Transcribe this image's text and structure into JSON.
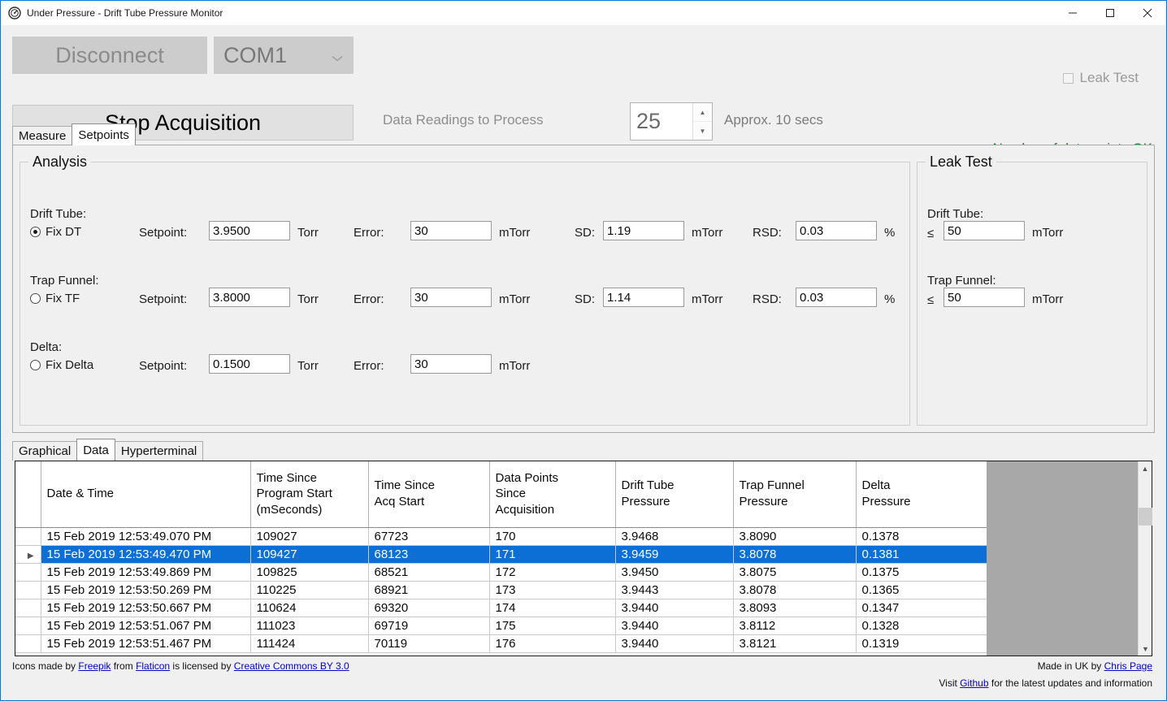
{
  "window": {
    "title": "Under Pressure - Drift Tube Pressure Monitor",
    "app_icon": "gauge-icon",
    "minimize": "minimize-icon",
    "maximize": "maximize-icon",
    "close": "close-icon"
  },
  "toolbar": {
    "disconnect_label": "Disconnect",
    "port_value": "COM1",
    "stop_label": "Stop Acquisition",
    "readings_label": "Data Readings to Process",
    "readings_value": "25",
    "approx_label": "Approx. 10 secs",
    "leak_test_label": "Leak Test",
    "status_label": "Number of data points OK",
    "status_color": "#0b8a1e"
  },
  "main_tabs": [
    {
      "label": "Measure",
      "active": false
    },
    {
      "label": "Setpoints",
      "active": true
    }
  ],
  "analysis": {
    "title": "Analysis",
    "drift_tube": {
      "group_label": "Drift Tube:",
      "radio_label": "Fix DT",
      "radio_checked": true,
      "setpoint_label": "Setpoint:",
      "setpoint_value": "3.9500",
      "setpoint_unit": "Torr",
      "error_label": "Error:",
      "error_value": "30",
      "error_unit": "mTorr",
      "sd_label": "SD:",
      "sd_value": "1.19",
      "sd_unit": "mTorr",
      "rsd_label": "RSD:",
      "rsd_value": "0.03",
      "rsd_unit": "%"
    },
    "trap_funnel": {
      "group_label": "Trap Funnel:",
      "radio_label": "Fix TF",
      "radio_checked": false,
      "setpoint_label": "Setpoint:",
      "setpoint_value": "3.8000",
      "setpoint_unit": "Torr",
      "error_label": "Error:",
      "error_value": "30",
      "error_unit": "mTorr",
      "sd_label": "SD:",
      "sd_value": "1.14",
      "sd_unit": "mTorr",
      "rsd_label": "RSD:",
      "rsd_value": "0.03",
      "rsd_unit": "%"
    },
    "delta": {
      "group_label": "Delta:",
      "radio_label": "Fix Delta",
      "radio_checked": false,
      "setpoint_label": "Setpoint:",
      "setpoint_value": "0.1500",
      "setpoint_unit": "Torr",
      "error_label": "Error:",
      "error_value": "30",
      "error_unit": "mTorr"
    }
  },
  "leak_test": {
    "title": "Leak Test",
    "drift_tube_label": "Drift Tube:",
    "drift_tube_op": "≤",
    "drift_tube_value": "50",
    "drift_tube_unit": "mTorr",
    "trap_funnel_label": "Trap Funnel:",
    "trap_funnel_op": "≤",
    "trap_funnel_value": "50",
    "trap_funnel_unit": "mTorr"
  },
  "bottom_tabs": [
    {
      "label": "Graphical",
      "active": false
    },
    {
      "label": "Data",
      "active": true
    },
    {
      "label": "Hyperterminal",
      "active": false
    }
  ],
  "grid": {
    "columns": [
      "Date & Time",
      "Time Since Program Start (mSeconds)",
      "Time Since Acq Start",
      "Data Points Since Acquisition",
      "Drift Tube Pressure",
      "Trap Funnel Pressure",
      "Delta Pressure"
    ],
    "column_lines": [
      [
        "Date & Time"
      ],
      [
        "Time Since",
        "Program Start",
        "(mSeconds)"
      ],
      [
        "Time Since",
        "Acq Start"
      ],
      [
        "Data Points",
        "Since",
        "Acquisition"
      ],
      [
        "Drift Tube",
        "Pressure"
      ],
      [
        "Trap Funnel",
        "Pressure"
      ],
      [
        "Delta",
        "Pressure"
      ]
    ],
    "selected_row_index": 1,
    "rows": [
      {
        "selected": false,
        "cells": [
          "15 Feb 2019 12:53:49.070 PM",
          "109027",
          "67723",
          "170",
          "3.9468",
          "3.8090",
          "0.1378"
        ]
      },
      {
        "selected": true,
        "cells": [
          "15 Feb 2019 12:53:49.470 PM",
          "109427",
          "68123",
          "171",
          "3.9459",
          "3.8078",
          "0.1381"
        ]
      },
      {
        "selected": false,
        "cells": [
          "15 Feb 2019 12:53:49.869 PM",
          "109825",
          "68521",
          "172",
          "3.9450",
          "3.8075",
          "0.1375"
        ]
      },
      {
        "selected": false,
        "cells": [
          "15 Feb 2019 12:53:50.269 PM",
          "110225",
          "68921",
          "173",
          "3.9443",
          "3.8078",
          "0.1365"
        ]
      },
      {
        "selected": false,
        "cells": [
          "15 Feb 2019 12:53:50.667 PM",
          "110624",
          "69320",
          "174",
          "3.9440",
          "3.8093",
          "0.1347"
        ]
      },
      {
        "selected": false,
        "cells": [
          "15 Feb 2019 12:53:51.067 PM",
          "111023",
          "69719",
          "175",
          "3.9440",
          "3.8112",
          "0.1328"
        ]
      },
      {
        "selected": false,
        "cells": [
          "15 Feb 2019 12:53:51.467 PM",
          "111424",
          "70119",
          "176",
          "3.9440",
          "3.8121",
          "0.1319"
        ]
      }
    ]
  },
  "footer": {
    "credit_pre": "Icons made by ",
    "credit_link1": "Freepik",
    "credit_mid1": " from ",
    "credit_link2": "Flaticon",
    "credit_mid2": " is licensed by ",
    "credit_link3": "Creative Commons BY 3.0",
    "made_pre": "Made in UK by ",
    "made_link": "Chris Page",
    "visit_pre": "Visit ",
    "visit_link": "Github",
    "visit_post": " for the latest updates and information"
  }
}
